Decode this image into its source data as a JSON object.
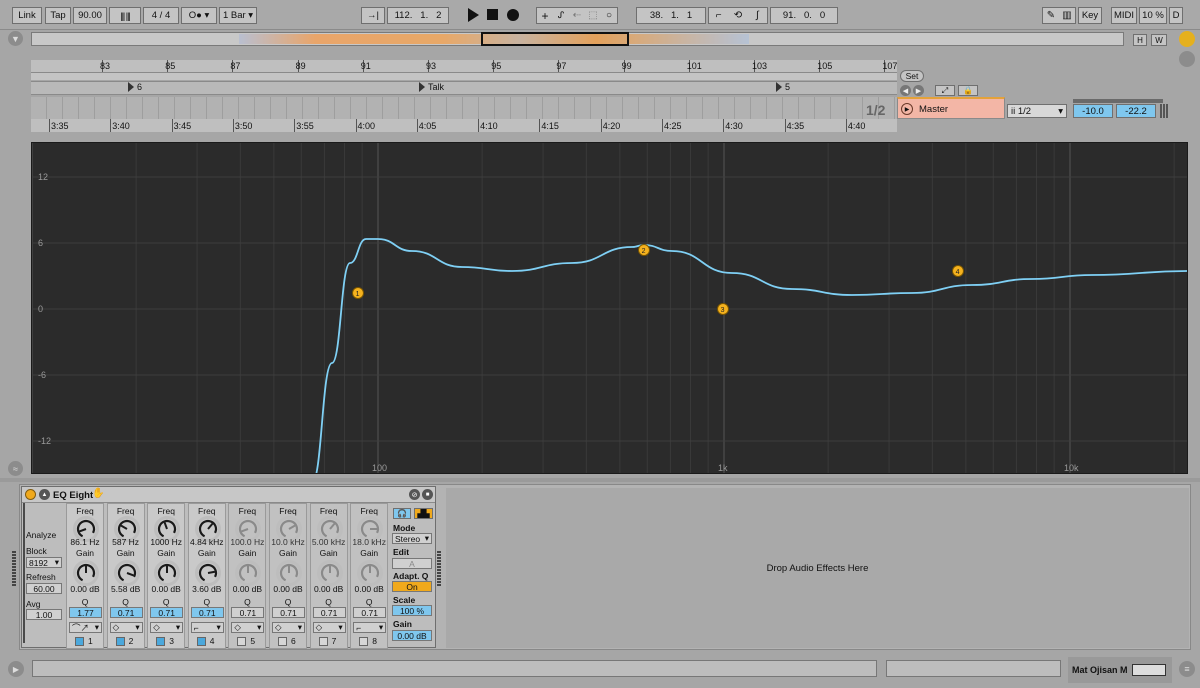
{
  "transport": {
    "link": "Link",
    "tap": "Tap",
    "tempo": "90.00",
    "signature": "4 / 4",
    "quantize": "1 Bar",
    "position": "112.   1.   2",
    "loop_start": "38.   1.   1",
    "loop_length": "91.   0.   0",
    "key": "Key",
    "midi": "MIDI",
    "cpu": "10 %",
    "disk": "D"
  },
  "overview": {
    "h_button": "H",
    "w_button": "W"
  },
  "bar_ruler": [
    "83",
    "85",
    "87",
    "89",
    "91",
    "93",
    "95",
    "97",
    "99",
    "101",
    "103",
    "105",
    "107"
  ],
  "locators": [
    "6",
    "Talk",
    "5"
  ],
  "time_ruler": [
    "3:35",
    "3:40",
    "3:45",
    "3:50",
    "3:55",
    "4:00",
    "4:05",
    "4:10",
    "4:15",
    "4:20",
    "4:25",
    "4:30",
    "4:35",
    "4:40"
  ],
  "set_label": "Set",
  "page_indicator": "1/2",
  "master_track": {
    "name": "Master",
    "input": "ii 1/2",
    "volume": "-10.0",
    "peak": "-22.2"
  },
  "eq_display": {
    "y_labels": [
      "12",
      "6",
      "0",
      "-6",
      "-12"
    ],
    "x_labels": [
      "100",
      "1k",
      "10k"
    ],
    "bands": [
      "1",
      "2",
      "3",
      "4"
    ],
    "curve_color": "#7fd0f5",
    "node_color": "#f5b21e"
  },
  "device": {
    "title": "EQ Eight",
    "analyze": "Analyze",
    "block_label": "Block",
    "block_value": "8192",
    "refresh_label": "Refresh",
    "refresh_value": "60.00",
    "avg_label": "Avg",
    "avg_value": "1.00",
    "freq_label": "Freq",
    "gain_label": "Gain",
    "q_label": "Q",
    "bands": [
      {
        "freq": "86.1 Hz",
        "gain": "0.00 dB",
        "q": "1.77",
        "num": "1",
        "active": true
      },
      {
        "freq": "587 Hz",
        "gain": "5.58 dB",
        "q": "0.71",
        "num": "2",
        "active": true
      },
      {
        "freq": "1000 Hz",
        "gain": "0.00 dB",
        "q": "0.71",
        "num": "3",
        "active": true
      },
      {
        "freq": "4.84 kHz",
        "gain": "3.60 dB",
        "q": "0.71",
        "num": "4",
        "active": true
      },
      {
        "freq": "100.0 Hz",
        "gain": "0.00 dB",
        "q": "0.71",
        "num": "5",
        "active": false
      },
      {
        "freq": "10.0 kHz",
        "gain": "0.00 dB",
        "q": "0.71",
        "num": "6",
        "active": false
      },
      {
        "freq": "5.00 kHz",
        "gain": "0.00 dB",
        "q": "0.71",
        "num": "7",
        "active": false
      },
      {
        "freq": "18.0 kHz",
        "gain": "0.00 dB",
        "q": "0.71",
        "num": "8",
        "active": false
      }
    ],
    "mode_label": "Mode",
    "mode_value": "Stereo",
    "edit_label": "Edit",
    "edit_value": "A",
    "adaptq_label": "Adapt. Q",
    "adaptq_value": "On",
    "scale_label": "Scale",
    "scale_value": "100 %",
    "gain_out_label": "Gain",
    "gain_out_value": "0.00 dB"
  },
  "drop_zone": "Drop Audio Effects Here",
  "status": {
    "track_name": "Mat Ojisan M"
  }
}
